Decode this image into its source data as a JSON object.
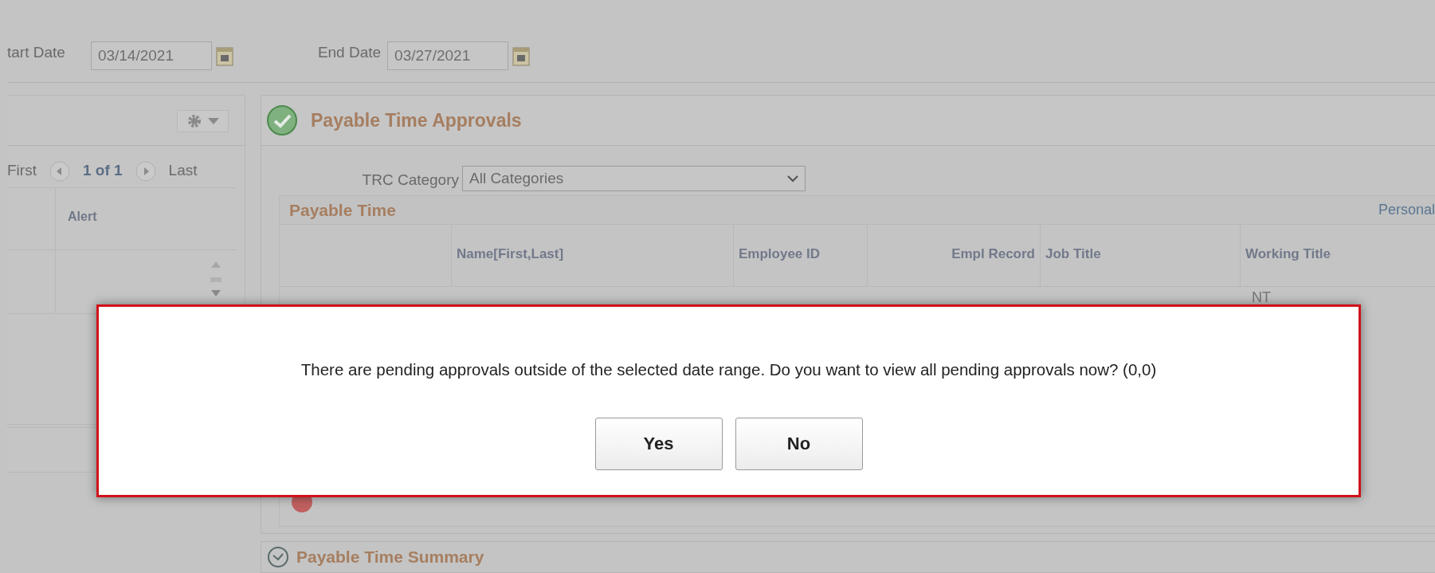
{
  "filters": {
    "start_label": "tart Date",
    "start_value": "03/14/2021",
    "end_label": "End Date",
    "end_value": "03/27/2021"
  },
  "left_panel": {
    "pager": {
      "first": "First",
      "page": "1 of 1",
      "last": "Last"
    },
    "columns": [
      "Alert"
    ]
  },
  "approvals": {
    "title": "Payable Time Approvals",
    "trc_label": "TRC Category",
    "trc_value": "All Categories",
    "grid_title": "Payable Time",
    "grid_link": "Personal",
    "columns": [
      "Name[First,Last]",
      "Employee ID",
      "Empl Record",
      "Job Title",
      "Working Title"
    ],
    "cell": "NT"
  },
  "summary": {
    "title": "Payable Time Summary"
  },
  "dialog": {
    "message": "There are pending approvals outside of the selected date range. Do you want to view all pending approvals now? (0,0)",
    "buttons": [
      "Yes",
      "No"
    ]
  }
}
